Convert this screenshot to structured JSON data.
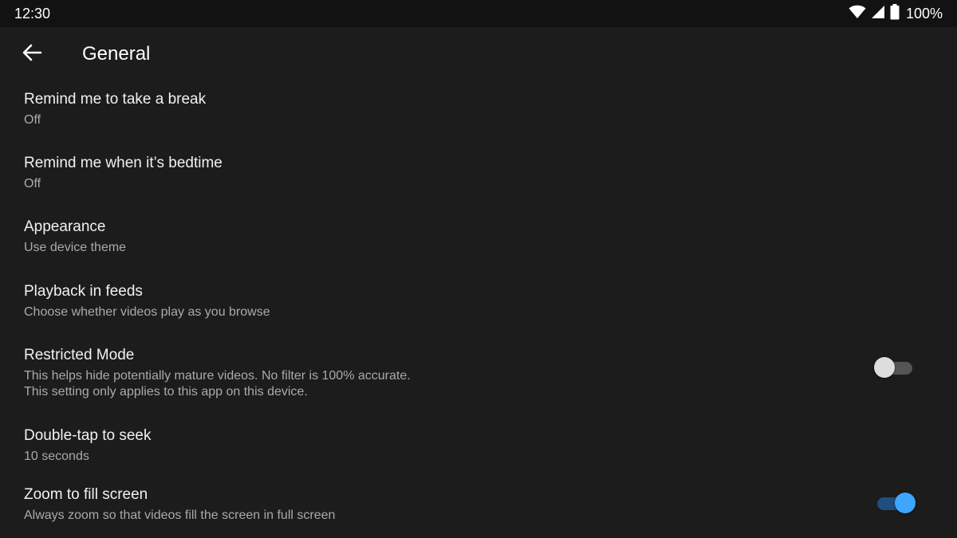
{
  "status_bar": {
    "time": "12:30",
    "battery": "100%",
    "icons": [
      "wifi-icon",
      "signal-icon",
      "battery-icon"
    ]
  },
  "app_bar": {
    "back_icon": "arrow-back-icon",
    "title": "General"
  },
  "settings": [
    {
      "title": "Remind me to take a break",
      "subtitle": "Off"
    },
    {
      "title": "Remind me when it’s bedtime",
      "subtitle": "Off"
    },
    {
      "title": "Appearance",
      "subtitle": "Use device theme"
    },
    {
      "title": "Playback in feeds",
      "subtitle": "Choose whether videos play as you browse"
    },
    {
      "title": "Restricted Mode",
      "subtitle_line1": "This helps hide potentially mature videos. No filter is 100% accurate.",
      "subtitle_line2": "This setting only applies to this app on this device.",
      "toggle_on": false
    },
    {
      "title": "Double-tap to seek",
      "subtitle": "10 seconds"
    },
    {
      "title": "Zoom to fill screen",
      "subtitle": "Always zoom so that videos fill the screen in full screen",
      "toggle_on": true
    }
  ],
  "colors": {
    "background": "#1c1c1c",
    "toggle_on_thumb": "#3ea6ff",
    "toggle_on_track": "#1f4e7d",
    "toggle_off_thumb": "#dddddd",
    "toggle_off_track": "#555555"
  }
}
